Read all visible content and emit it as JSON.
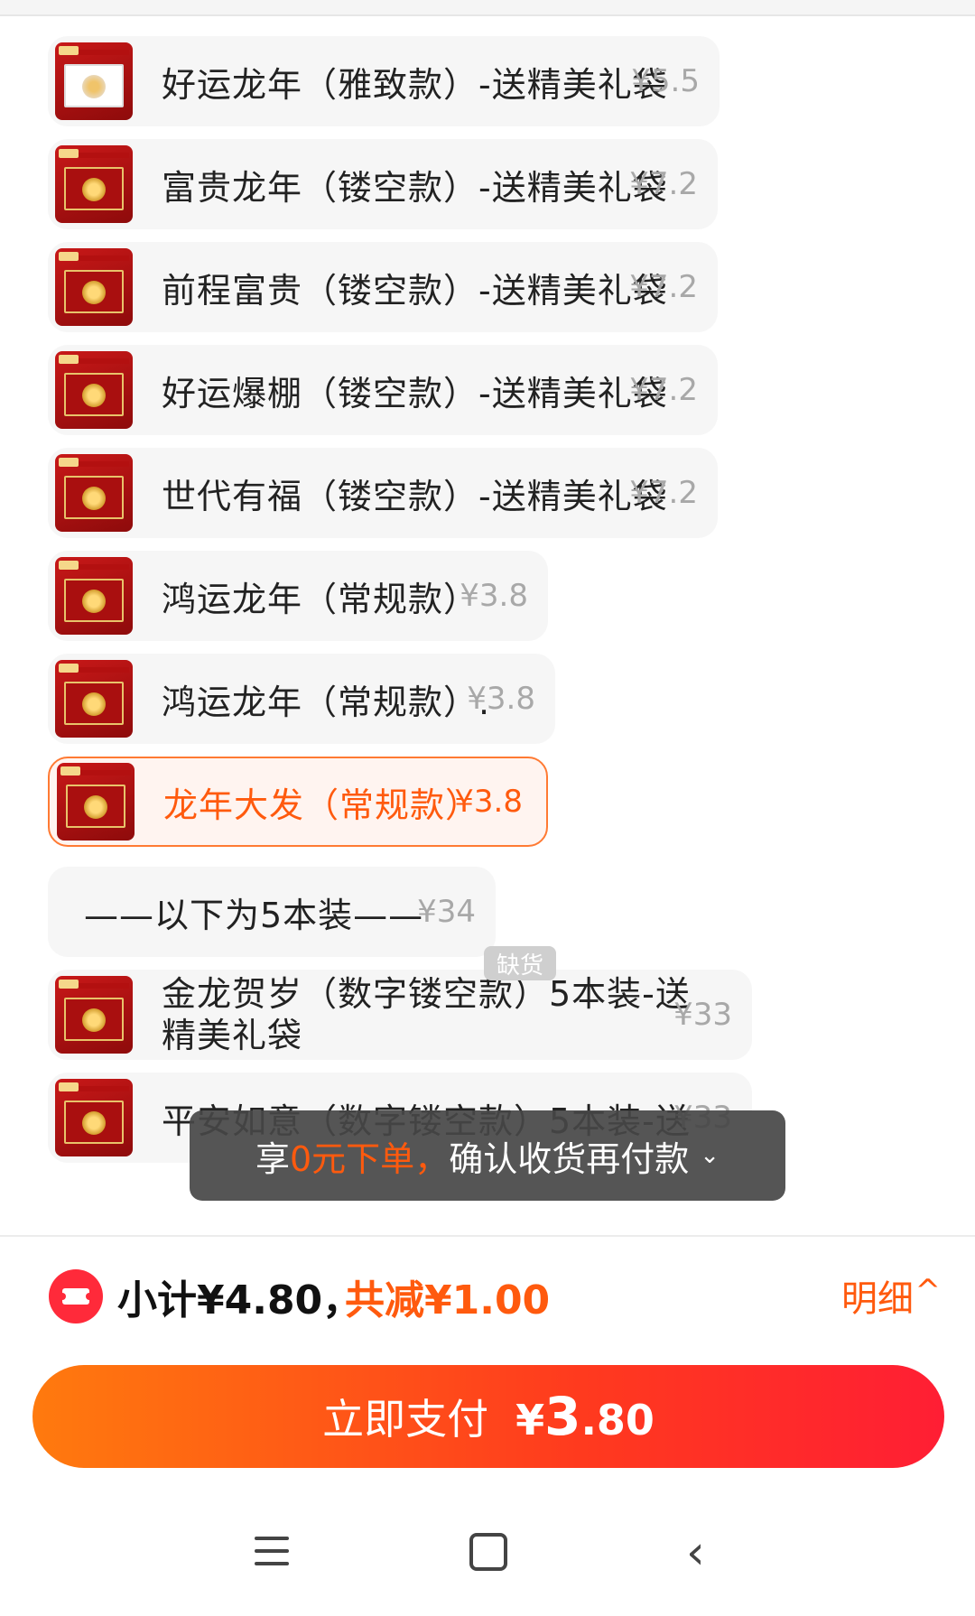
{
  "sku_list": [
    {
      "name": "好运龙年（雅致款）-送精美礼袋",
      "price": "¥5.5",
      "thumb": "white"
    },
    {
      "name": "富贵龙年（镂空款）-送精美礼袋",
      "price": "¥7.2",
      "thumb": "red"
    },
    {
      "name": "前程富贵（镂空款）-送精美礼袋",
      "price": "¥7.2",
      "thumb": "red"
    },
    {
      "name": "好运爆棚（镂空款）-送精美礼袋",
      "price": "¥7.2",
      "thumb": "red"
    },
    {
      "name": "世代有福（镂空款）-送精美礼袋",
      "price": "¥7.2",
      "thumb": "red"
    },
    {
      "name": "鸿运龙年（常规款）",
      "price": "¥3.8",
      "thumb": "red"
    },
    {
      "name": "鸿运龙年（常规款）.",
      "price": "¥3.8",
      "thumb": "red"
    },
    {
      "name": "龙年大发（常规款）",
      "price": "¥3.8",
      "thumb": "red",
      "selected": true
    },
    {
      "name": "——以下为5本装——",
      "price": "¥34",
      "thumb": "none"
    },
    {
      "name": "金龙贺岁（数字镂空款）5本装-送精美礼袋",
      "price": "¥33",
      "thumb": "red"
    },
    {
      "name": "平安如意（数字镂空款）5本装-送",
      "price": "¥33",
      "thumb": "red"
    }
  ],
  "stock_badge": "缺货",
  "toast": {
    "prefix": "享",
    "highlight": "0元下单，",
    "suffix": "确认收货再付款",
    "chevron": "⌄"
  },
  "summary": {
    "subtotal": "小计¥4.80，",
    "discount": "共减¥1.00",
    "detail": "明细",
    "detail_chevron": "^"
  },
  "pay_button": {
    "label": "立即支付",
    "currency": "¥",
    "amount_int": "3",
    "amount_dec": ".80"
  },
  "colors": {
    "accent": "#ff5a0e",
    "selected_border": "#ff7a33",
    "pay_gradient_start": "#ff7a0e",
    "pay_gradient_end": "#ff1e34"
  },
  "icons": [
    "coupon-icon",
    "menu-icon",
    "home-icon",
    "back-icon",
    "chevron-down-icon",
    "chevron-up-icon"
  ]
}
